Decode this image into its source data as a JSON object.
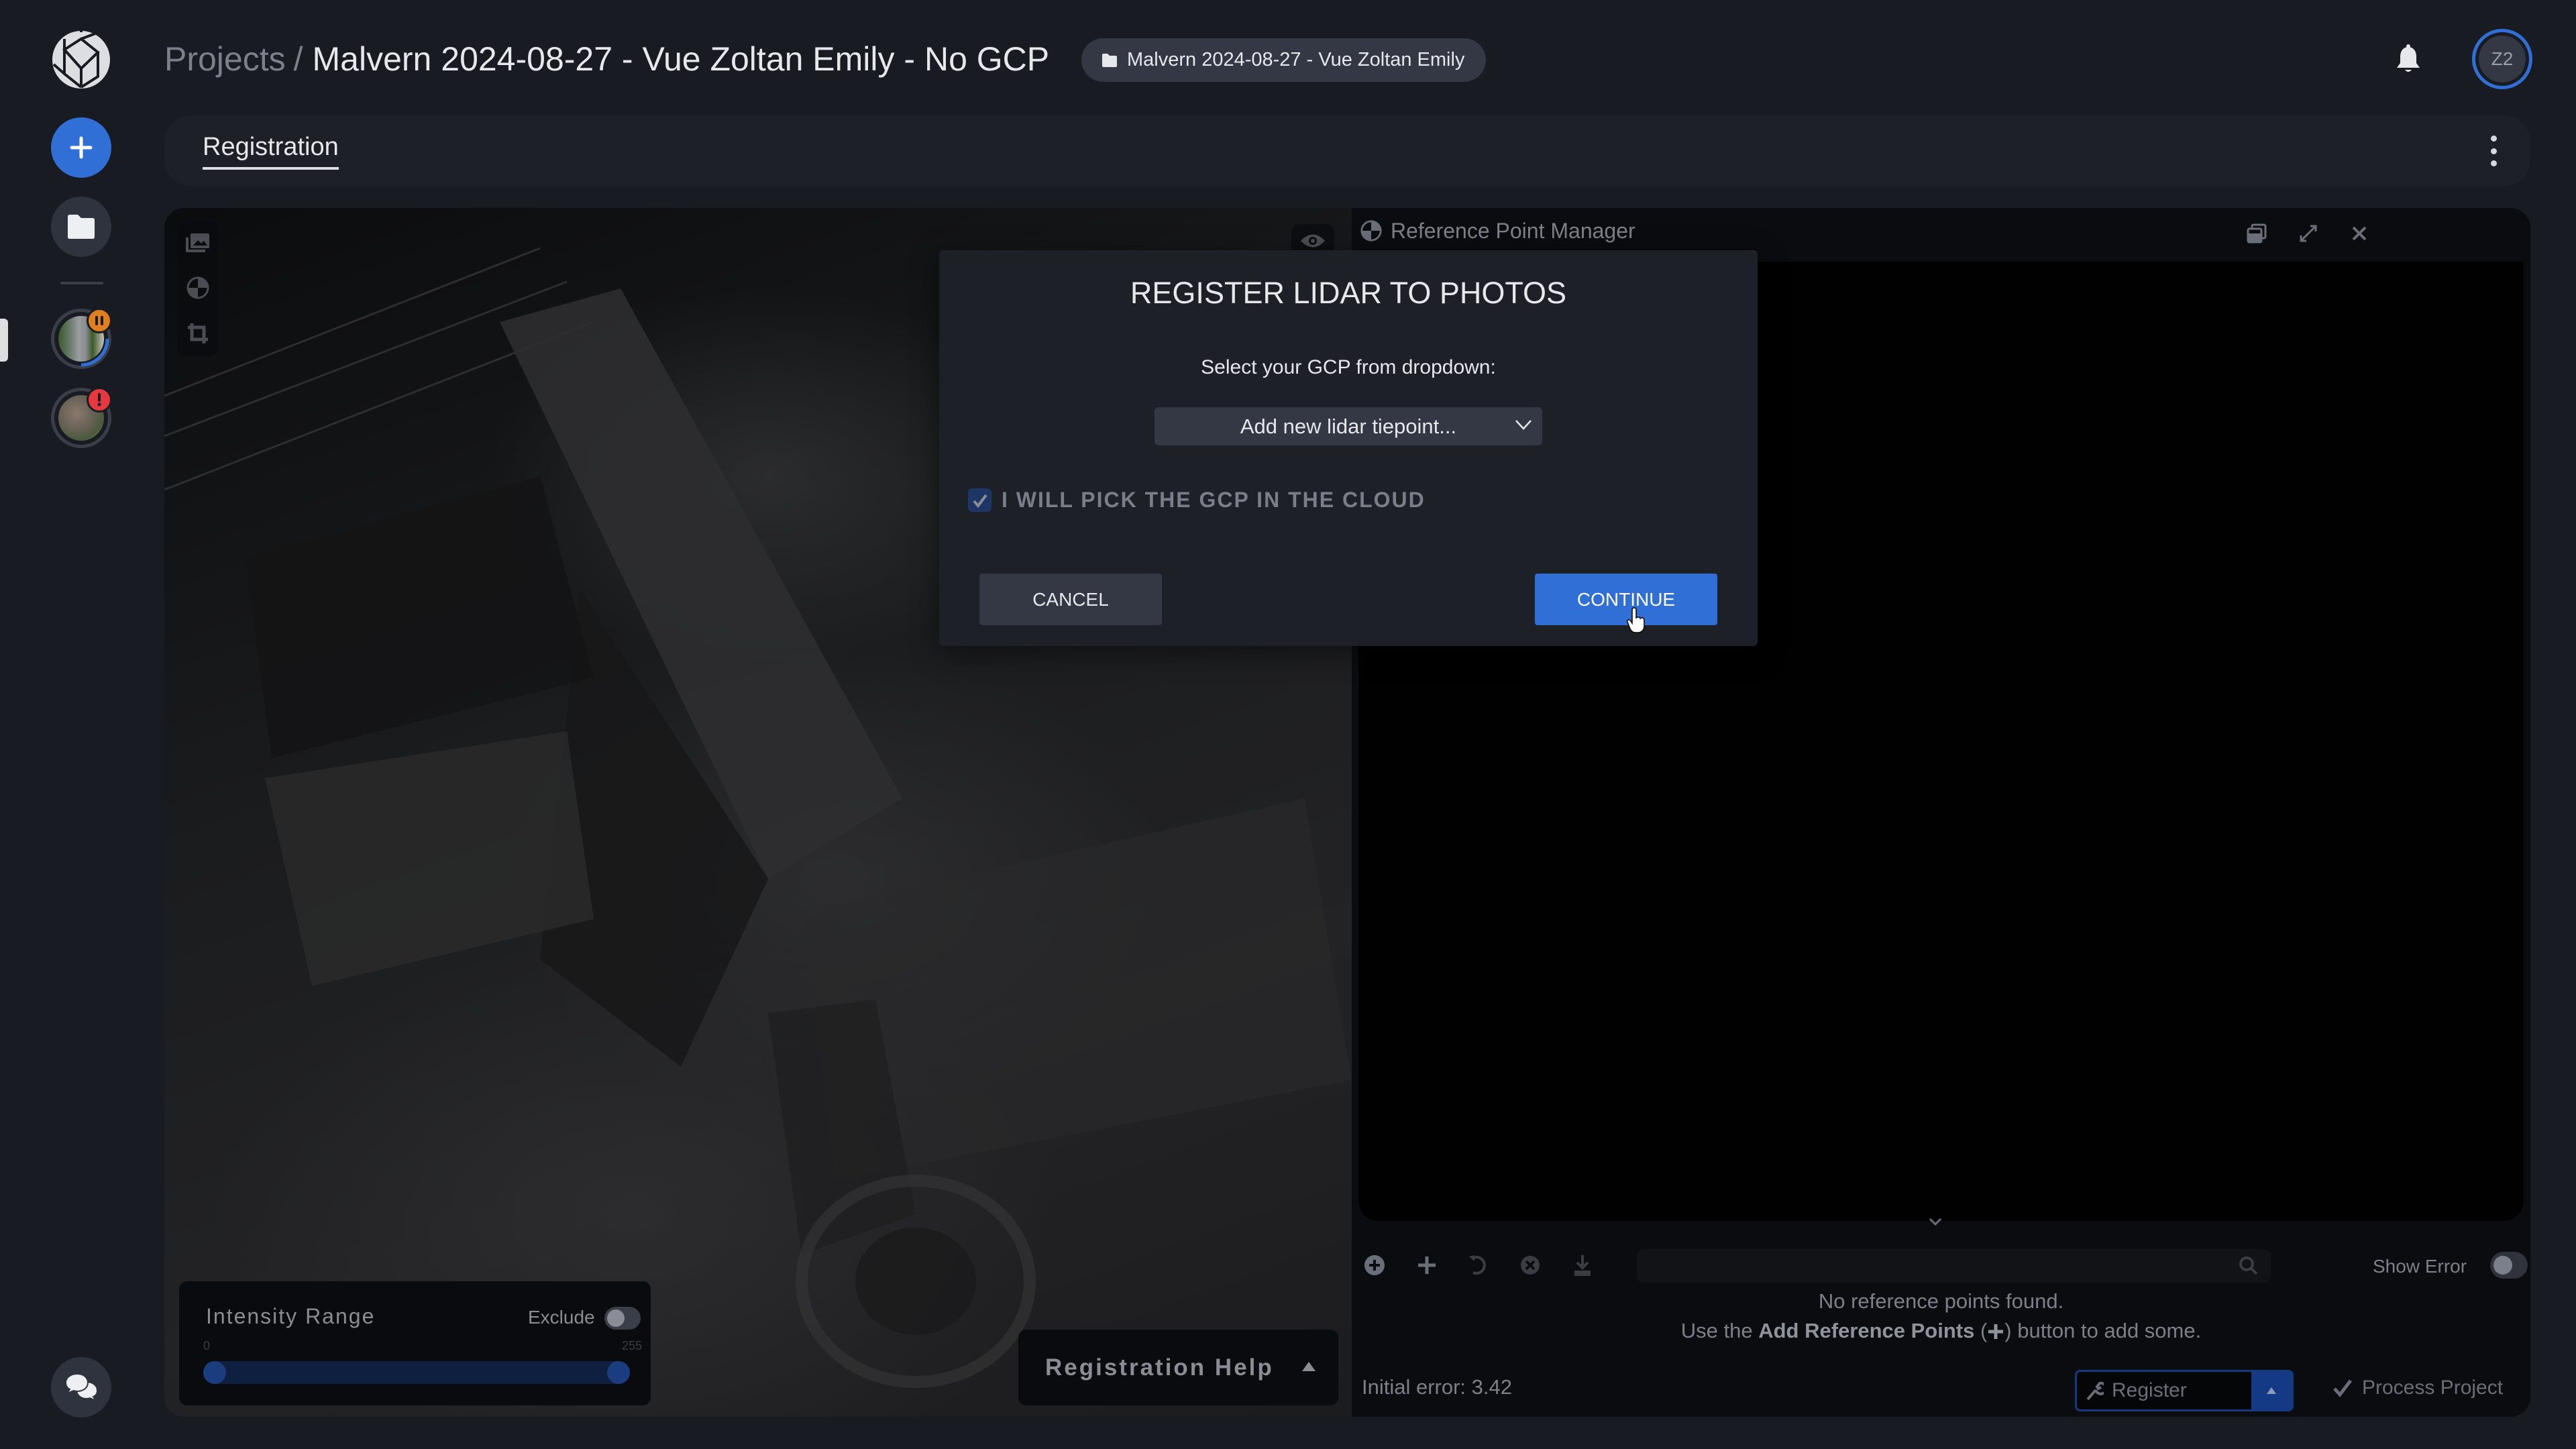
{
  "header": {
    "breadcrumb_root": "Projects",
    "breadcrumb_separator": "/",
    "project_title": "Malvern 2024-08-27 - Vue Zoltan Emily - No GCP",
    "project_chip_label": "Malvern 2024-08-27 - Vue Zoltan Emily",
    "avatar_initials": "Z2"
  },
  "sidebar": {
    "logo_icon": "aperture-logo-icon",
    "items": [
      {
        "name": "add-project",
        "icon": "plus-icon"
      },
      {
        "name": "projects",
        "icon": "folder-icon"
      }
    ],
    "projects": [
      {
        "name": "project-street",
        "status": "paused",
        "badge_color": "#e07f1f",
        "progress": 0.3
      },
      {
        "name": "project-terrain",
        "status": "error",
        "badge_color": "#e5393f"
      }
    ],
    "chat_icon": "chat-bubbles-icon"
  },
  "tabs": [
    {
      "label": "Registration",
      "active": true
    }
  ],
  "viewer": {
    "tools": [
      "images-icon",
      "target-icon",
      "crop-icon"
    ],
    "intensity": {
      "title": "Intensity Range",
      "exclude_label": "Exclude",
      "exclude_on": false,
      "min_label": "0",
      "max_label": "255",
      "range_low": 0,
      "range_high": 255
    },
    "help_label": "Registration Help"
  },
  "reference_panel": {
    "title": "Reference Point Manager",
    "search_placeholder": "",
    "show_error_label": "Show Error",
    "show_error_on": false,
    "empty_line1": "No reference points found.",
    "empty_line2_prefix": "Use the ",
    "empty_line2_bold": "Add Reference Points",
    "empty_line2_suffix": " button to add some.",
    "initial_error_label": "Initial error: 3.42",
    "register_label": "Register",
    "process_label": "Process Project"
  },
  "dialog": {
    "title": "REGISTER LIDAR TO PHOTOS",
    "prompt": "Select your GCP from dropdown:",
    "select_value": "Add new lidar tiepoint...",
    "checkbox_label": "I WILL PICK THE GCP IN THE CLOUD",
    "checkbox_checked": true,
    "cancel_label": "CANCEL",
    "continue_label": "CONTINUE"
  },
  "colors": {
    "accent": "#2f6fd6",
    "background": "#181b22",
    "panel": "#1e2028"
  }
}
